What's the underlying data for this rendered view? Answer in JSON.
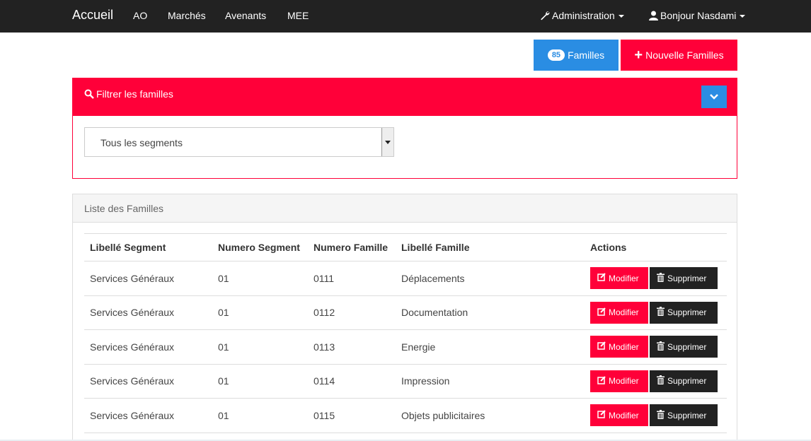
{
  "navbar": {
    "brand": "Accueil",
    "items": [
      "AO",
      "Marchés",
      "Avenants",
      "MEE"
    ],
    "admin_label": "Administration",
    "user_label": "Bonjour Nasdami"
  },
  "toolbar": {
    "count_badge": "85",
    "familles_label": "Familles",
    "nouvelle_label": "Nouvelle Familles"
  },
  "filter": {
    "title": "Filtrer les familles",
    "segment_selected": "Tous les segments"
  },
  "list": {
    "title": "Liste des Familles",
    "columns": [
      "Libellé Segment",
      "Numero Segment",
      "Numero Famille",
      "Libellé Famille",
      "Actions"
    ],
    "modify_label": "Modifier",
    "delete_label": "Supprimer",
    "rows": [
      {
        "segment": "Services Généraux",
        "num_segment": "01",
        "num_famille": "0111",
        "libelle": "Déplacements"
      },
      {
        "segment": "Services Généraux",
        "num_segment": "01",
        "num_famille": "0112",
        "libelle": "Documentation"
      },
      {
        "segment": "Services Généraux",
        "num_segment": "01",
        "num_famille": "0113",
        "libelle": "Energie"
      },
      {
        "segment": "Services Généraux",
        "num_segment": "01",
        "num_famille": "0114",
        "libelle": "Impression"
      },
      {
        "segment": "Services Généraux",
        "num_segment": "01",
        "num_famille": "0115",
        "libelle": "Objets publicitaires"
      }
    ]
  },
  "colors": {
    "navbar": "#222222",
    "primary_red": "#ff0039",
    "primary_blue": "#2a8de3"
  }
}
